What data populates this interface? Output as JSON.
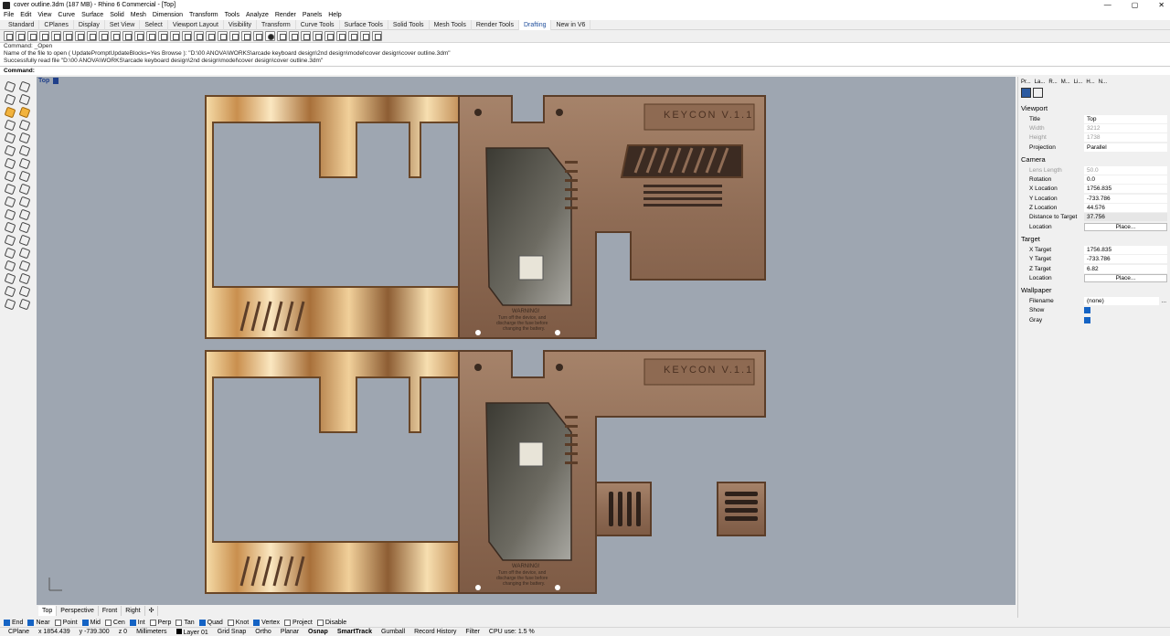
{
  "window": {
    "title": "cover outline.3dm (187 MB) - Rhino 6 Commercial - [Top]",
    "controls": [
      "—",
      "▢",
      "✕"
    ]
  },
  "menu": [
    "File",
    "Edit",
    "View",
    "Curve",
    "Surface",
    "Solid",
    "Mesh",
    "Dimension",
    "Transform",
    "Tools",
    "Analyze",
    "Render",
    "Panels",
    "Help"
  ],
  "toolbar_tabs": [
    {
      "label": "Standard",
      "active": false
    },
    {
      "label": "CPlanes",
      "active": false
    },
    {
      "label": "Display",
      "active": false
    },
    {
      "label": "Set View",
      "active": false
    },
    {
      "label": "Select",
      "active": false
    },
    {
      "label": "Viewport Layout",
      "active": false
    },
    {
      "label": "Visibility",
      "active": false
    },
    {
      "label": "Transform",
      "active": false
    },
    {
      "label": "Curve Tools",
      "active": false
    },
    {
      "label": "Surface Tools",
      "active": false
    },
    {
      "label": "Solid Tools",
      "active": false
    },
    {
      "label": "Mesh Tools",
      "active": false
    },
    {
      "label": "Render Tools",
      "active": false
    },
    {
      "label": "Drafting",
      "active": true
    },
    {
      "label": "New in V6",
      "active": false
    }
  ],
  "command_history": [
    "Command: _Open",
    "Name of the file to open ( UpdatePromptUpdateBlocks=Yes  Browse ): \"D:\\00 ANOVA\\WORKS\\arcade keyboard design\\2nd design\\model\\cover design\\cover outline.3dm\"",
    "Successfully read file \"D:\\00 ANOVA\\WORKS\\arcade keyboard design\\2nd design\\model\\cover design\\cover outline.3dm\""
  ],
  "command_prompt": "Command:",
  "viewport": {
    "name": "Top",
    "keycon_label": "KEYCON V.1.1",
    "warning_title": "WARNING!",
    "warning_lines": [
      "Turn off the device, and",
      "discharge the fuse before",
      "changing the battery."
    ]
  },
  "view_tabs": [
    "Top",
    "Perspective",
    "Front",
    "Right",
    "✣"
  ],
  "osnaps": [
    {
      "label": "End",
      "on": true
    },
    {
      "label": "Near",
      "on": true
    },
    {
      "label": "Point",
      "on": false
    },
    {
      "label": "Mid",
      "on": true
    },
    {
      "label": "Cen",
      "on": false
    },
    {
      "label": "Int",
      "on": true
    },
    {
      "label": "Perp",
      "on": false
    },
    {
      "label": "Tan",
      "on": false
    },
    {
      "label": "Quad",
      "on": true
    },
    {
      "label": "Knot",
      "on": false
    },
    {
      "label": "Vertex",
      "on": true
    },
    {
      "label": "Project",
      "on": false
    },
    {
      "label": "Disable",
      "on": false
    }
  ],
  "status": {
    "cplane": "CPlane",
    "x": "x 1854.439",
    "y": "y -739.300",
    "z": "z 0",
    "units": "Millimeters",
    "layer": "Layer 01",
    "grid_snap": "Grid Snap",
    "ortho": "Ortho",
    "planar": "Planar",
    "osnap": "Osnap",
    "smarttrack": "SmartTrack",
    "gumball": "Gumball",
    "record_history": "Record History",
    "filter": "Filter",
    "cpu": "CPU use: 1.5 %"
  },
  "panel": {
    "tabs": [
      "Pr...",
      "La...",
      "R...",
      "M...",
      "Li...",
      "H...",
      "N..."
    ],
    "viewport": {
      "heading": "Viewport",
      "title": "Top",
      "width": "3212",
      "height": "1738",
      "projection": "Parallel"
    },
    "camera": {
      "heading": "Camera",
      "lens_length": "50.0",
      "rotation": "0.0",
      "x_location": "1756.835",
      "y_location": "-733.786",
      "z_location": "44.576",
      "distance_to_target": "37.756",
      "location_btn": "Place..."
    },
    "target": {
      "heading": "Target",
      "x_target": "1756.835",
      "y_target": "-733.786",
      "z_target": "6.82",
      "location_btn": "Place..."
    },
    "wallpaper": {
      "heading": "Wallpaper",
      "filename": "(none)",
      "show": true,
      "gray": true
    },
    "labels": {
      "title": "Title",
      "width": "Width",
      "height": "Height",
      "projection": "Projection",
      "lens_length": "Lens Length",
      "rotation": "Rotation",
      "x_location": "X Location",
      "y_location": "Y Location",
      "z_location": "Z Location",
      "distance_to_target": "Distance to Target",
      "location": "Location",
      "x_target": "X Target",
      "y_target": "Y Target",
      "z_target": "Z Target",
      "filename": "Filename",
      "show": "Show",
      "gray": "Gray",
      "browse": "..."
    }
  }
}
